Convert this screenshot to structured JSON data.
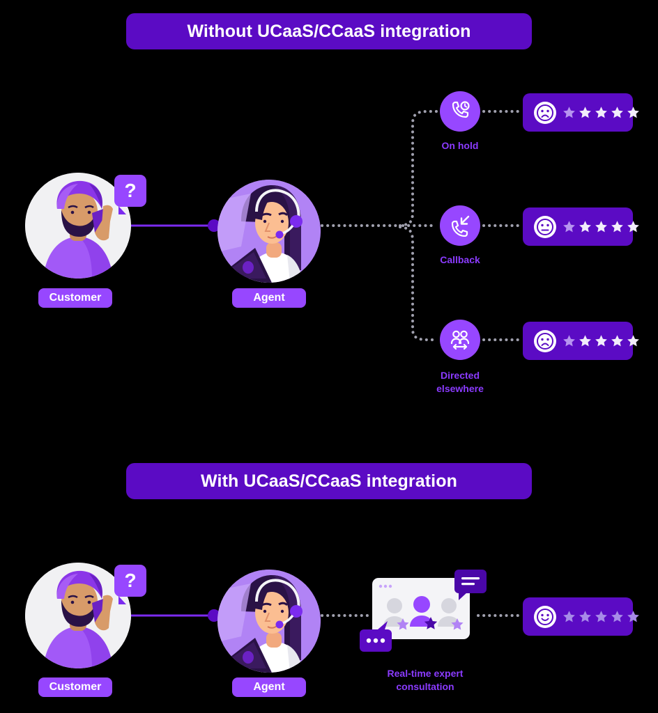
{
  "sections": {
    "top": {
      "banner_label": "Without UCaaS/CCaaS integration",
      "customer_label": "Customer",
      "agent_label": "Agent",
      "question_mark": "?",
      "outcomes": [
        {
          "icon": "phone-clock-icon",
          "label": "On hold",
          "rating": {
            "face": "sad-face-icon",
            "stars_total": 5,
            "stars_filled": 1
          }
        },
        {
          "icon": "phone-callback-icon",
          "label": "Callback",
          "rating": {
            "face": "neutral-face-icon",
            "stars_total": 5,
            "stars_filled": 1
          }
        },
        {
          "icon": "people-transfer-icon",
          "label": "Directed\nelsewhere",
          "label_line1": "Directed",
          "label_line2": "elsewhere",
          "rating": {
            "face": "sad-face-icon",
            "stars_total": 5,
            "stars_filled": 1
          }
        }
      ]
    },
    "bottom": {
      "banner_label": "With UCaaS/CCaaS integration",
      "customer_label": "Customer",
      "agent_label": "Agent",
      "question_mark": "?",
      "consultation_label_line1": "Real-time expert",
      "consultation_label_line2": "consultation",
      "rating": {
        "face": "happy-face-icon",
        "stars_total": 5,
        "stars_filled": 5
      }
    }
  },
  "colors": {
    "banner_purple": "#5B0BC4",
    "pill_purple": "#9747FF",
    "label_purple": "#8B3BFF",
    "dotted_gray": "#A0A0AE",
    "arrow_purple": "#7B2BEF",
    "star_bright": "#F2EDFB",
    "star_dim": "#B794F0",
    "star_light": "#A78BE8",
    "card_white": "#F4F4F7",
    "background": "#000000"
  }
}
